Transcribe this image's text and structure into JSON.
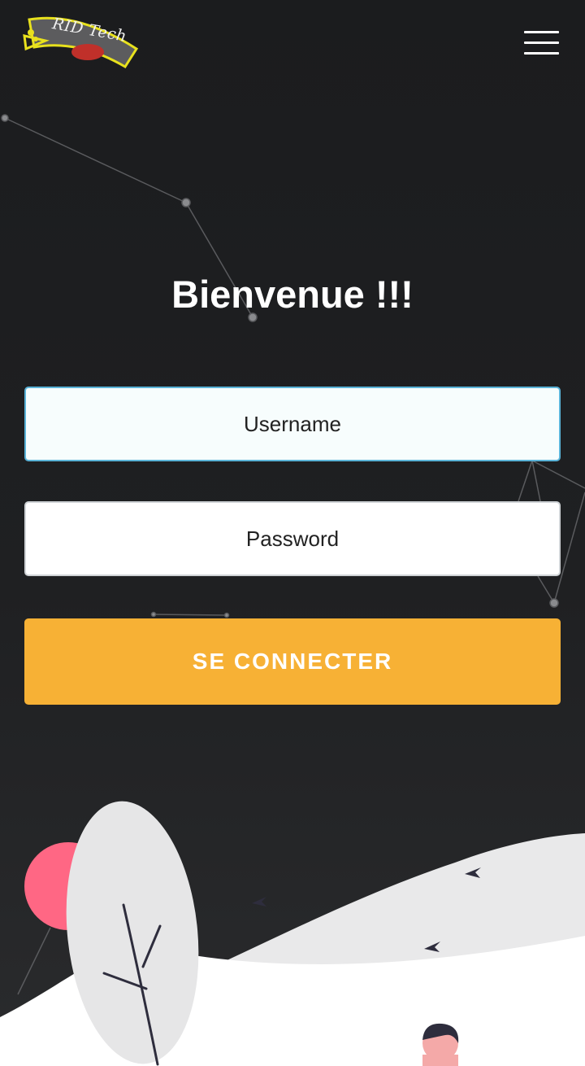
{
  "brand": {
    "logo_text": "RID Tech"
  },
  "header": {
    "menu_icon": "hamburger-menu-icon"
  },
  "login": {
    "title": "Bienvenue !!!",
    "username_placeholder": "Username",
    "password_placeholder": "Password",
    "submit_label": "SE CONNECTER"
  },
  "colors": {
    "background": "#1f2022",
    "accent": "#f7b135",
    "focus_border": "#5ab3d8",
    "sun": "#ff6784",
    "hill": "#e9e9ea"
  }
}
